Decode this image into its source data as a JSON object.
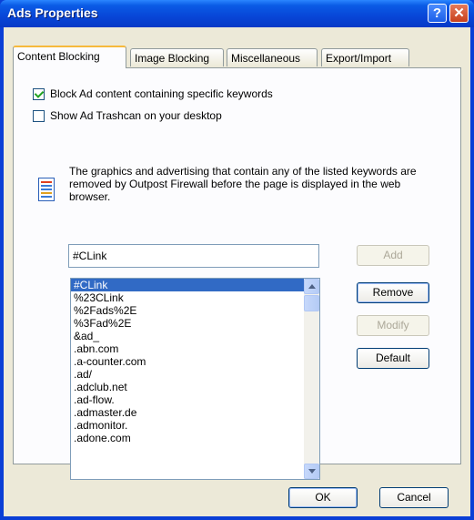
{
  "window": {
    "title": "Ads Properties",
    "help_glyph": "?",
    "close_glyph": "✕"
  },
  "tabs": [
    {
      "label": "Content Blocking"
    },
    {
      "label": "Image Blocking"
    },
    {
      "label": "Miscellaneous"
    },
    {
      "label": "Export/Import"
    }
  ],
  "options": {
    "block_keywords": {
      "label": "Block Ad content containing specific keywords",
      "checked": true
    },
    "show_trashcan": {
      "label": "Show Ad Trashcan on your desktop",
      "checked": false
    }
  },
  "description": "The graphics and advertising that contain any of the listed keywords are removed by Outpost Firewall before the page is displayed in the web browser.",
  "keyword_input": {
    "value": "#CLink"
  },
  "keywords": [
    "#CLink",
    "%23CLink",
    "%2Fads%2E",
    "%3Fad%2E",
    "&ad_",
    ".abn.com",
    ".a-counter.com",
    ".ad/",
    ".adclub.net",
    ".ad-flow.",
    ".admaster.de",
    ".admonitor.",
    ".adone.com"
  ],
  "selected_keyword": "#CLink",
  "buttons": {
    "add": "Add",
    "remove": "Remove",
    "modify": "Modify",
    "default": "Default"
  },
  "footer": {
    "ok": "OK",
    "cancel": "Cancel"
  },
  "colors": {
    "titlebar": "#0a5be6",
    "selection": "#316ac5",
    "tab_highlight": "#f6b93c"
  }
}
